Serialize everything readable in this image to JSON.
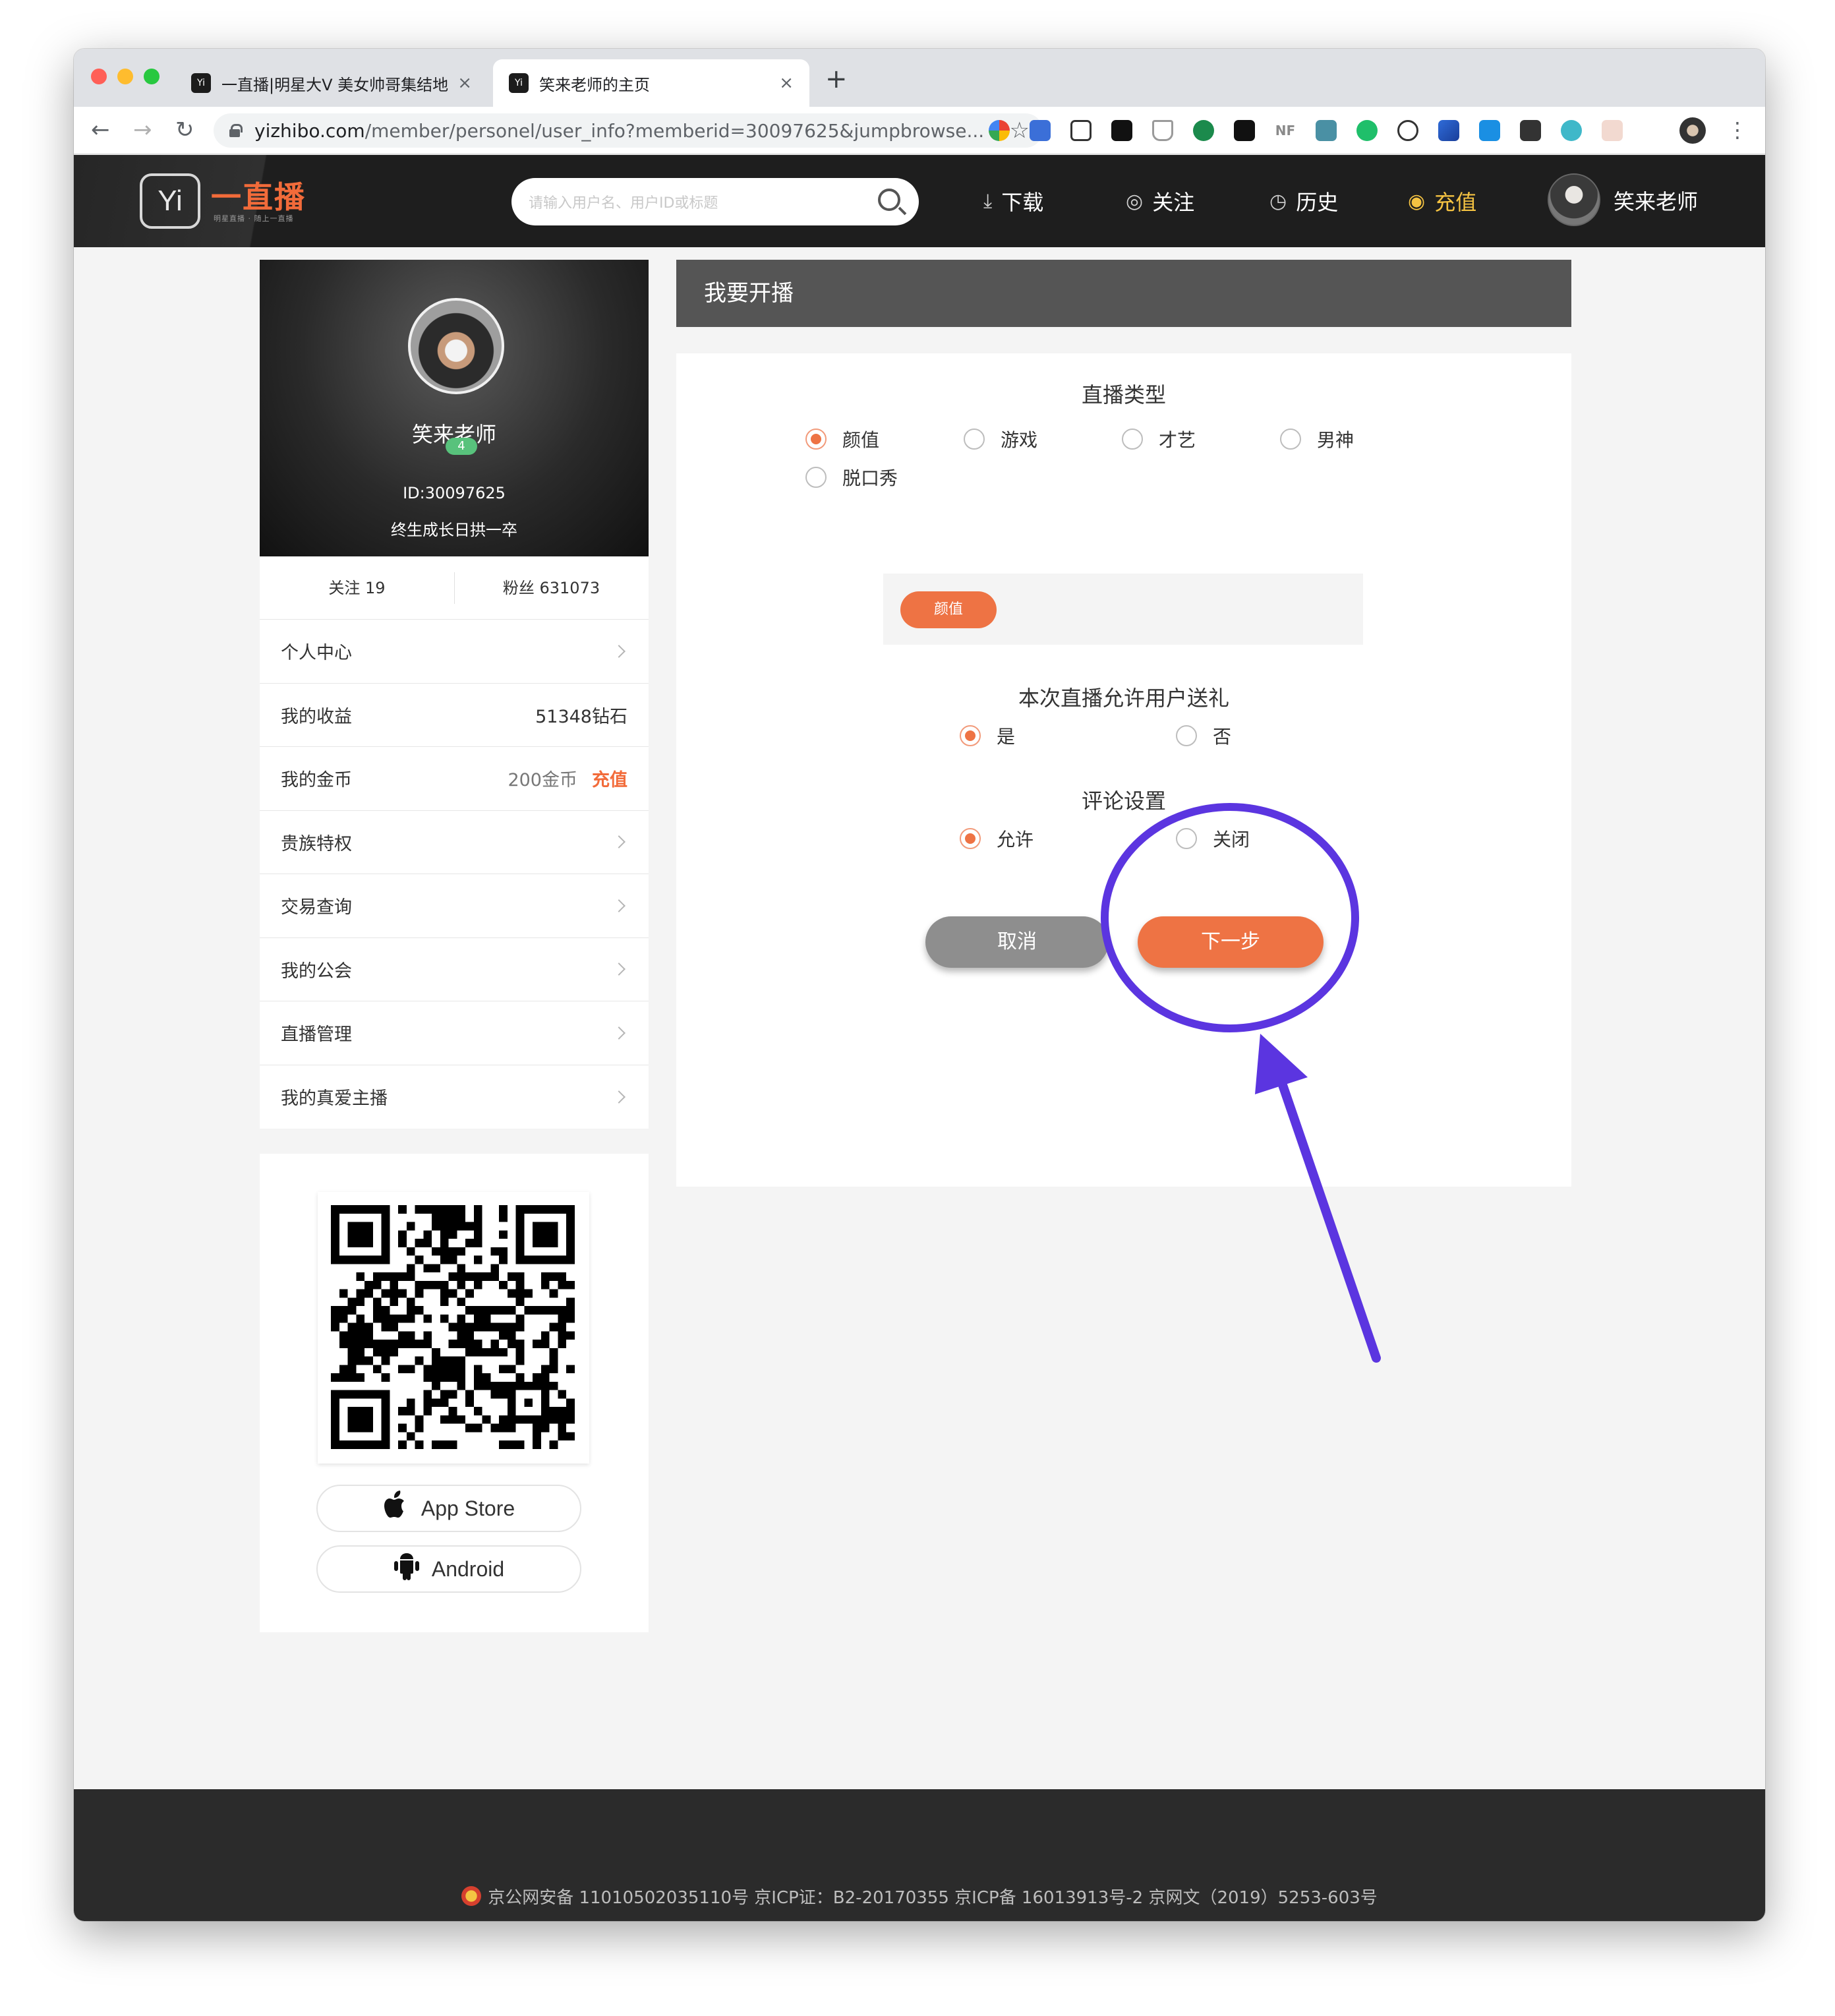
{
  "browser": {
    "tabs": [
      {
        "title": "一直播|明星大V 美女帅哥集结地",
        "favicon": "Yi"
      },
      {
        "title": "笑来老师的主页",
        "favicon": "Yi"
      }
    ],
    "new_tab": "+",
    "close": "×",
    "url_host": "yizhibo.com",
    "url_path": "/member/personel/user_info?memberid=30097625&jumpbrowse...",
    "star": "☆",
    "back": "←",
    "forward": "→",
    "reload": "↻",
    "menu": "⋮",
    "ext_nf": "NF"
  },
  "site": {
    "logo_mark": "Yi",
    "logo_text": "一直播",
    "logo_sub": "明星直播 · 随上一直播",
    "search_placeholder": "请输入用户名、用户ID或标题",
    "nav": {
      "download": "下载",
      "follow": "关注",
      "history": "历史",
      "recharge": "充值",
      "username": "笑来老师"
    }
  },
  "profile": {
    "name": "笑来老师",
    "level": "4",
    "id": "ID:30097625",
    "signature": "终生成长日拱一卒",
    "following": "关注 19",
    "fans": "粉丝 631073"
  },
  "menu": {
    "personal_center": "个人中心",
    "earnings": "我的收益",
    "earnings_value": "51348钻石",
    "coins": "我的金币",
    "coins_value": "200金币",
    "coins_recharge": "充值",
    "noble": "贵族特权",
    "transactions": "交易查询",
    "guild": "我的公会",
    "live_manage": "直播管理",
    "true_love": "我的真爱主播"
  },
  "download": {
    "app_store": "App Store",
    "android": "Android"
  },
  "form": {
    "header": "我要开播",
    "type_title": "直播类型",
    "types": [
      "颜值",
      "游戏",
      "才艺",
      "男神",
      "脱口秀"
    ],
    "selected_type": "颜值",
    "selected_tag": "颜值",
    "gift_title": "本次直播允许用户送礼",
    "gift_yes": "是",
    "gift_no": "否",
    "comment_title": "评论设置",
    "comment_allow": "允许",
    "comment_close": "关闭",
    "cancel": "取消",
    "next": "下一步"
  },
  "footer": {
    "text": "京公网安备 11010502035110号    京ICP证：B2-20170355    京ICP备 16013913号-2    京网文（2019）5253-603号"
  },
  "colors": {
    "accent": "#ee7344",
    "annotation": "#5b35e0",
    "header_bg": "#1e1e1e",
    "gold": "#f5c342"
  }
}
